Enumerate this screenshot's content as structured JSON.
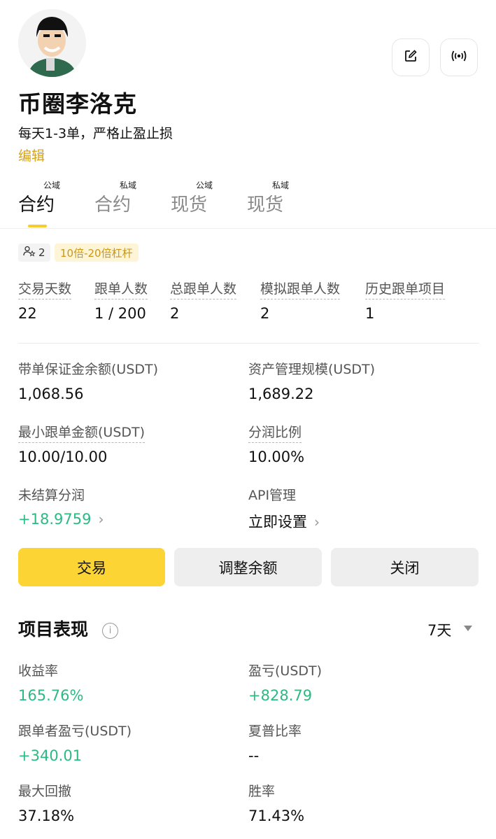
{
  "profile": {
    "nickname": "币圈李洛克",
    "bio": "每天1-3单，严格止盈止损",
    "edit_label": "编辑"
  },
  "header_actions": {
    "edit_icon": "edit-icon",
    "broadcast_icon": "broadcast-icon"
  },
  "tabs": [
    {
      "tag": "公域",
      "label": "合约",
      "active": true
    },
    {
      "tag": "私域",
      "label": "合约",
      "active": false
    },
    {
      "tag": "公域",
      "label": "现货",
      "active": false
    },
    {
      "tag": "私域",
      "label": "现货",
      "active": false
    }
  ],
  "badges": {
    "users_count": "2",
    "leverage": "10倍-20倍杠杆"
  },
  "stats": [
    {
      "label": "交易天数",
      "value": "22"
    },
    {
      "label": "跟单人数",
      "value": "1 / 200"
    },
    {
      "label": "总跟单人数",
      "value": "2"
    },
    {
      "label": "模拟跟单人数",
      "value": "2"
    },
    {
      "label": "历史跟单项目",
      "value": "1"
    }
  ],
  "info": {
    "margin_balance_label": "带单保证金余额(USDT)",
    "margin_balance_value": "1,068.56",
    "aum_label": "资产管理规模(USDT)",
    "aum_value": "1,689.22",
    "min_copy_label": "最小跟单金额(USDT)",
    "min_copy_value": "10.00/10.00",
    "profit_share_label": "分润比例",
    "profit_share_value": "10.00%",
    "unsettled_label": "未结算分润",
    "unsettled_value": "+18.9759",
    "api_label": "API管理",
    "api_value": "立即设置"
  },
  "actions": {
    "trade": "交易",
    "adjust_balance": "调整余额",
    "close": "关闭"
  },
  "performance": {
    "title": "项目表现",
    "period": "7天",
    "roi_label": "收益率",
    "roi_value": "165.76%",
    "pnl_label": "盈亏(USDT)",
    "pnl_value": "+828.79",
    "follower_pnl_label": "跟单者盈亏(USDT)",
    "follower_pnl_value": "+340.01",
    "sharpe_label": "夏普比率",
    "sharpe_value": "--",
    "max_drawdown_label": "最大回撤",
    "max_drawdown_value": "37.18%",
    "win_rate_label": "胜率",
    "win_rate_value": "71.43%"
  },
  "colors": {
    "accent": "#fcd535",
    "edit_link": "#d4a21a",
    "positive": "#2eb983",
    "leverage_text": "#c9961c"
  }
}
